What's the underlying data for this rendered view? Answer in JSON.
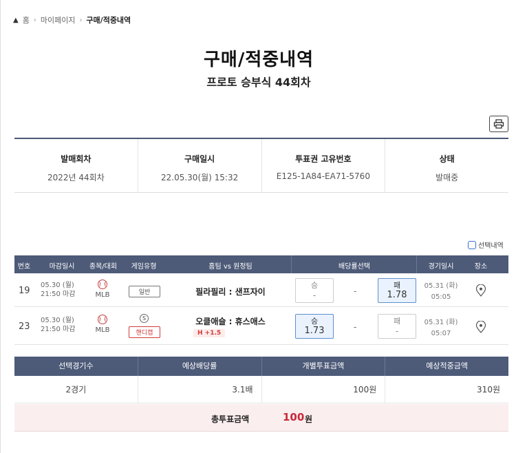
{
  "breadcrumb": {
    "home": "홈",
    "mypage": "마이페이지",
    "current": "구매/적중내역"
  },
  "title": "구매/적중내역",
  "subtitle": "프로토 승부식 44회차",
  "info": {
    "round_label": "발매회차",
    "round_value": "2022년 44회차",
    "purchase_label": "구매일시",
    "purchase_value": "22.05.30(월) 15:32",
    "ticket_label": "투표권 고유번호",
    "ticket_value": "E125-1A84-EA71-5760",
    "status_label": "상태",
    "status_value": "발매중"
  },
  "select_history_label": "선택내역",
  "game_headers": {
    "num": "번호",
    "deadline": "마감일시",
    "sport": "종목/대회",
    "type": "게임유형",
    "teams": "홈팀 vs 원정팀",
    "odds": "배당률선택",
    "date": "경기일시",
    "place": "장소"
  },
  "games": [
    {
      "num": "19",
      "deadline_date": "05.30 (월)",
      "deadline_time": "21:50 마감",
      "sport": "MLB",
      "type": "일반",
      "teams": "필라필리 : 샌프자이",
      "win_label": "승",
      "win_value": "-",
      "draw": "-",
      "lose_label": "패",
      "lose_value": "1.78",
      "selected": "lose",
      "game_date": "05.31 (화)",
      "game_time": "05:05"
    },
    {
      "num": "23",
      "deadline_date": "05.30 (월)",
      "deadline_time": "21:50 마감",
      "sport": "MLB",
      "type_icon": "S",
      "type": "핸디캡",
      "teams": "오클애슬 : 휴스애스",
      "handicap": "H +1.5",
      "win_label": "승",
      "win_value": "1.73",
      "draw": "-",
      "lose_label": "패",
      "lose_value": "-",
      "selected": "win",
      "game_date": "05.31 (화)",
      "game_time": "05:07"
    }
  ],
  "summary": {
    "headers": [
      "선택경기수",
      "예상배당률",
      "개별투표금액",
      "예상적중금액"
    ],
    "values": [
      "2경기",
      "3.1배",
      "100원",
      "310원"
    ],
    "total_label": "총투표금액",
    "total_amount": "100",
    "total_unit": "원"
  },
  "colors": {
    "header_bg": "#4d5a78",
    "accent_red": "#c9283a",
    "selected_odds": "#eaf2fd"
  }
}
